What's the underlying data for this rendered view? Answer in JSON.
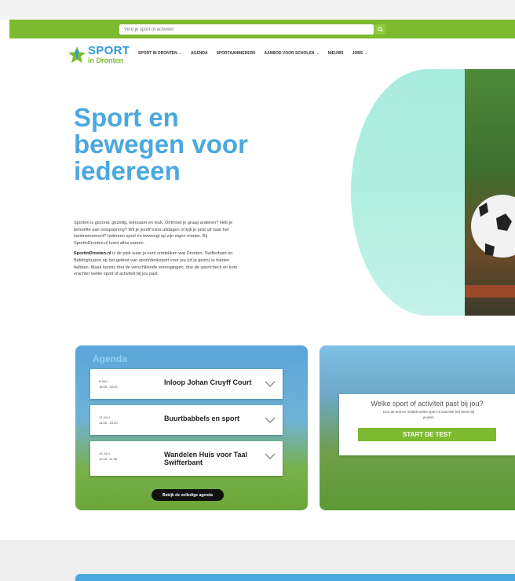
{
  "search": {
    "placeholder": "Vind je sport of activiteit"
  },
  "logo": {
    "word1": "SPORT",
    "word2": "in Dronten"
  },
  "nav": [
    {
      "label": "SPORT IN DRONTEN",
      "dropdown": true
    },
    {
      "label": "AGENDA",
      "dropdown": false
    },
    {
      "label": "SPORTAANBIEDERS",
      "dropdown": false
    },
    {
      "label": "AANBOD VOOR SCHOLEN",
      "dropdown": true
    },
    {
      "label": "NIEUWS",
      "dropdown": false
    },
    {
      "label": "JOBS",
      "dropdown": true
    }
  ],
  "hero": {
    "title_line1": "Sport en",
    "title_line2": "bewegen voor",
    "title_line3": "iedereen",
    "p1": "Sporten is gezond, gezellig, leerzaam en leuk. Ontmoet je graag anderen? Heb je behoefte aan ontspanning? Wil je jezelf extra uitdagen of kijk je juist uit naar het kantinemoment? Iedereen sport en beweegt op zijn eigen manier. Bij SportinDronten.nl komt alles samen.",
    "p2_brand": "SportinDronten.nl",
    "p2": " is de plek waar je kunt ontdekken wat Dronten, Swifterbant en Biddinghuizen op het gebied van sport/denksport voor jou (of je gezin) te bieden hebben. Maak kennis met de verschillende verenigingen, doe de sportcheck en kom erachter welke sport of activiteit bij jou past."
  },
  "agenda": {
    "title": "Agenda",
    "events": [
      {
        "date": "8 JULI",
        "time": "14.00 - 16.00",
        "title": "Inloop Johan Cruyff Court"
      },
      {
        "date": "12 JULI",
        "time": "14.00 - 16.00",
        "title": "Buurtbabbels en sport"
      },
      {
        "date": "14 JULI",
        "time": "10.00 - 11.00",
        "title": "Wandelen Huis voor Taal Swifterbant"
      }
    ],
    "button": "Bekijk de volledige agenda"
  },
  "test": {
    "question": "Welke sport of activiteit past bij jou?",
    "sub": "Doe de test en ontdek welke sport of activiteit het beste bij je past.",
    "button": "START DE TEST"
  },
  "colors": {
    "green": "#7dba2f",
    "blue": "#4aa8e0",
    "mint": "#a7ecdd"
  }
}
